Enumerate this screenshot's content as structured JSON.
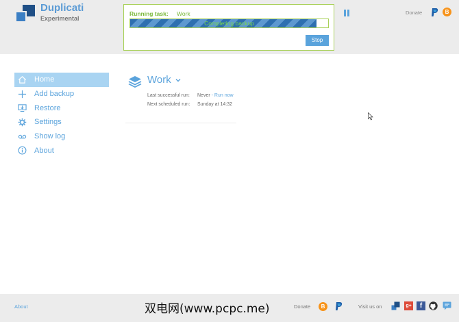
{
  "brand": {
    "name": "Duplicati",
    "subtitle": "Experimental"
  },
  "task": {
    "label": "Running task:",
    "name": "Work",
    "progress_text": "Completing backup",
    "progress_percent": 94,
    "stop_label": "Stop"
  },
  "header": {
    "donate_label": "Donate"
  },
  "sidebar": {
    "items": [
      {
        "label": "Home",
        "icon": "home-icon",
        "active": true
      },
      {
        "label": "Add backup",
        "icon": "plus-icon"
      },
      {
        "label": "Restore",
        "icon": "restore-icon"
      },
      {
        "label": "Settings",
        "icon": "gear-icon"
      },
      {
        "label": "Show log",
        "icon": "log-icon"
      },
      {
        "label": "About",
        "icon": "info-icon"
      }
    ]
  },
  "backup": {
    "name": "Work",
    "last_run_label": "Last successful run:",
    "last_run_value": "Never",
    "run_now_label": "- Run now",
    "next_run_label": "Next scheduled run:",
    "next_run_value": "Sunday at 14:32"
  },
  "footer": {
    "about_label": "About",
    "watermark": "双电网(www.pcpc.me)",
    "donate_label": "Donate",
    "visit_label": "Visit us on"
  },
  "colors": {
    "accent": "#5aa3dc",
    "active_bg": "#a9d4f2",
    "task_green": "#7ab83a",
    "header_bg": "#ececec"
  }
}
